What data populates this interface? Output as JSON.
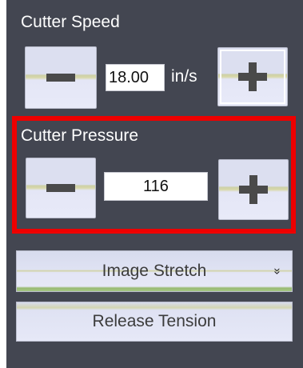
{
  "cutter_speed": {
    "label": "Cutter Speed",
    "value": "18.00",
    "unit": "in/s"
  },
  "cutter_pressure": {
    "label": "Cutter Pressure",
    "value": "116"
  },
  "image_stretch": {
    "label": "Image Stretch",
    "chevron": "»"
  },
  "release_tension": {
    "label": "Release Tension"
  },
  "icons": {
    "decrease": "minus-icon",
    "increase": "plus-icon",
    "dropdown": "double-chevron-down-icon"
  },
  "colors": {
    "panel_background": "#434651",
    "highlight_border": "#ee0000"
  }
}
